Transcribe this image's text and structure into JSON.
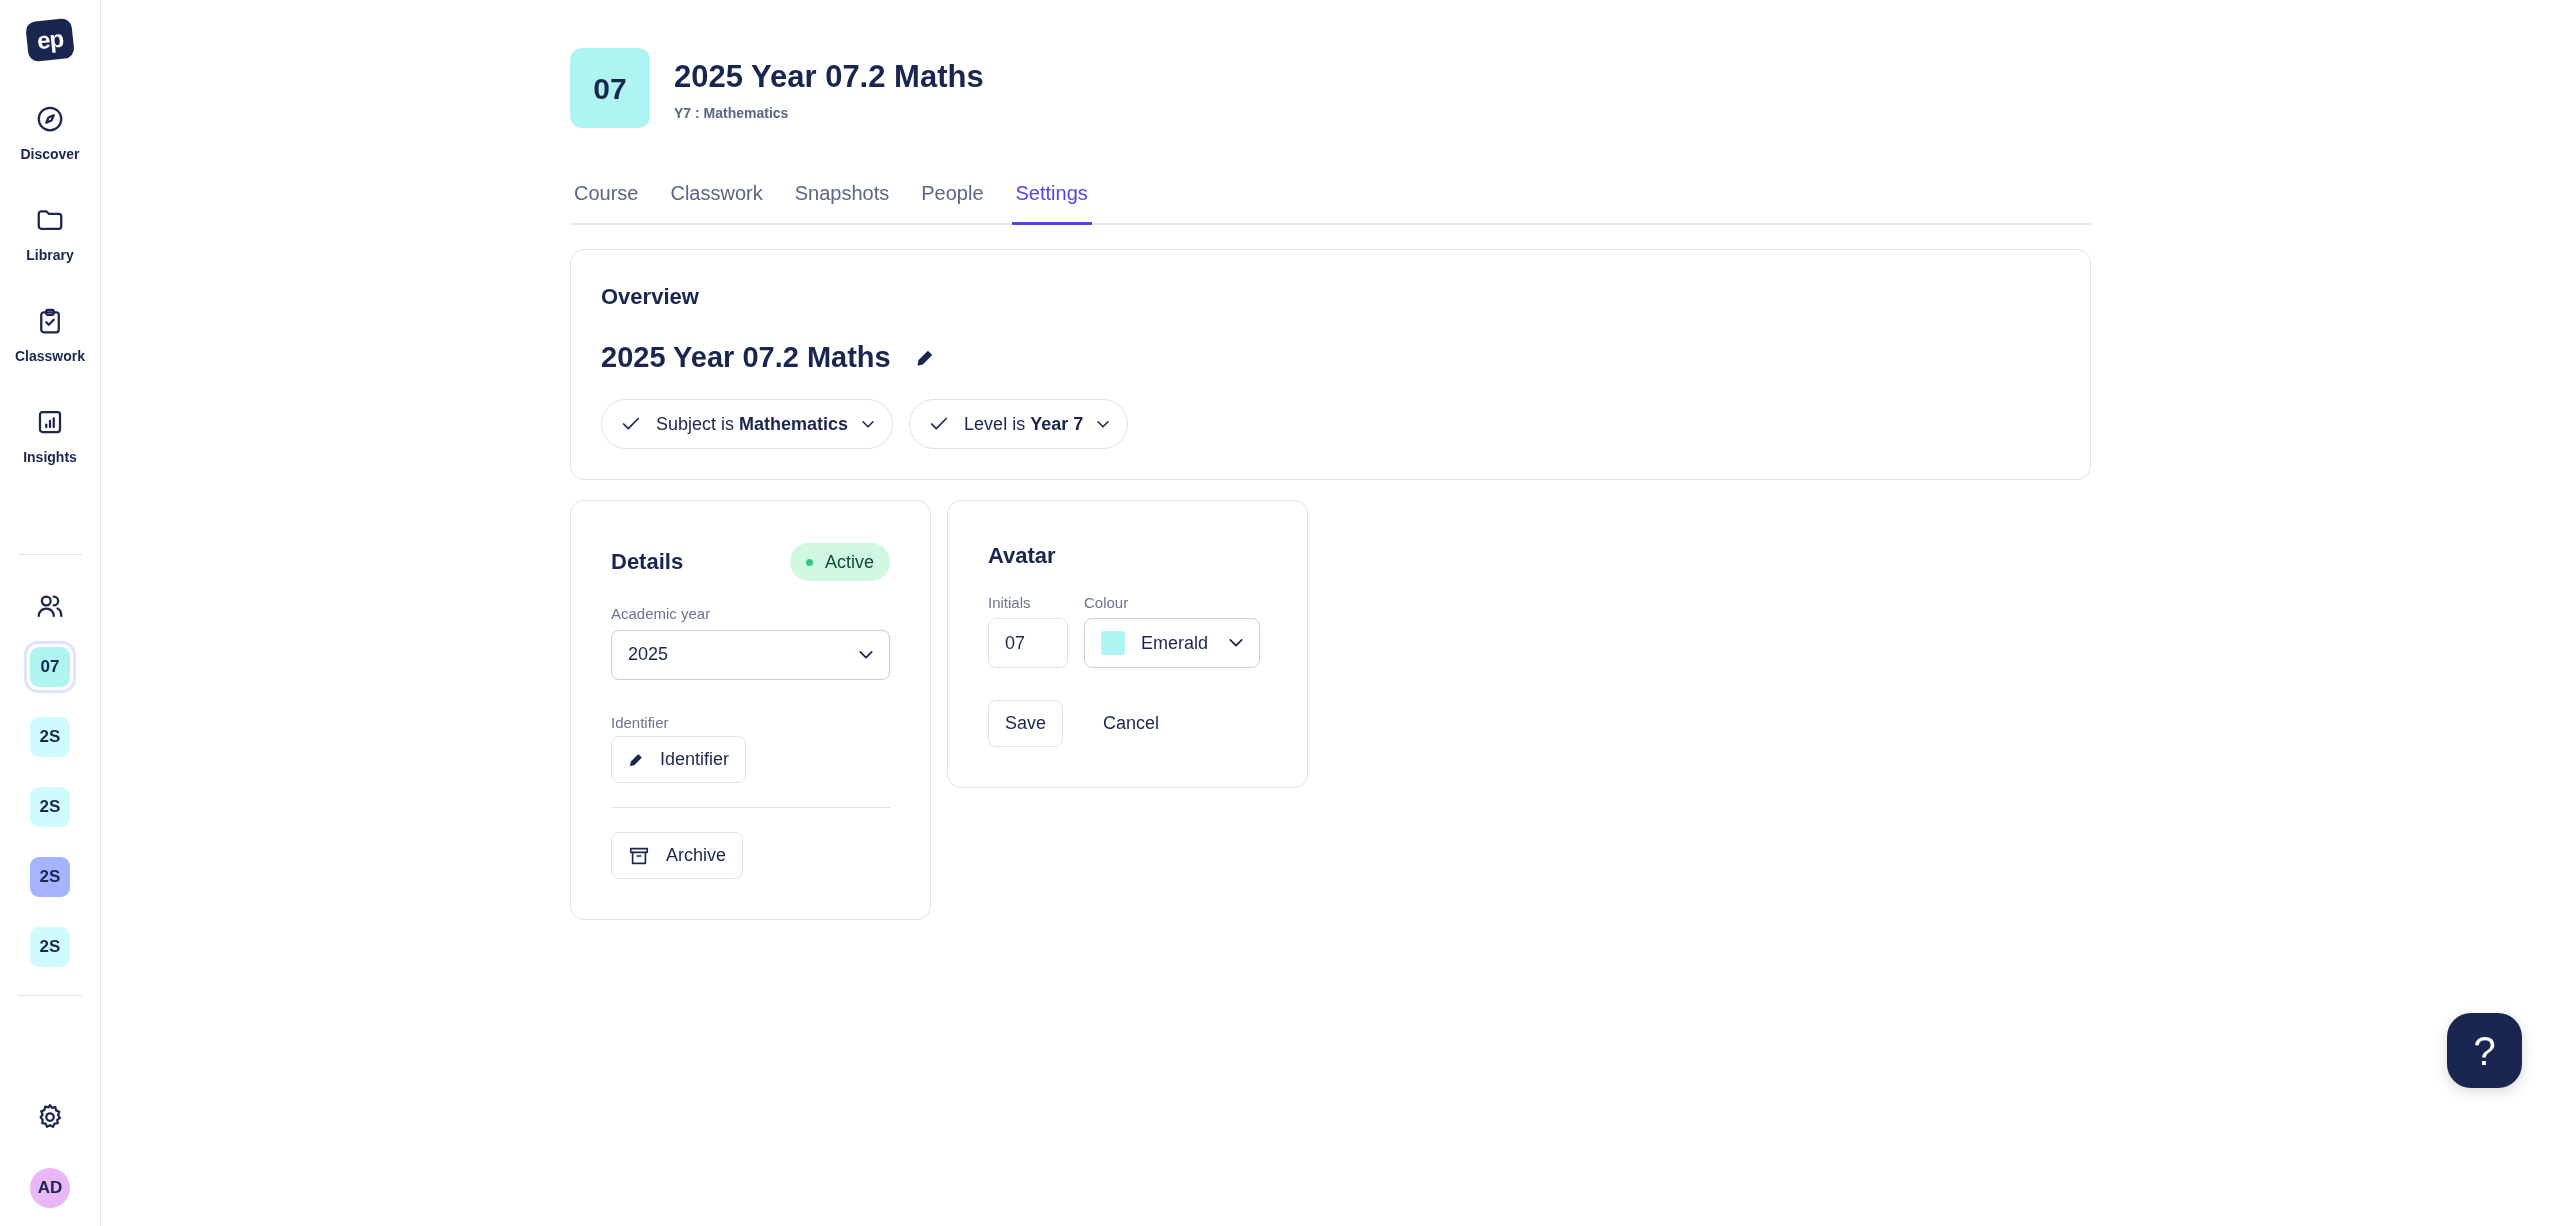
{
  "sidebar": {
    "logo": "ep",
    "nav": [
      {
        "label": "Discover"
      },
      {
        "label": "Library"
      },
      {
        "label": "Classwork"
      },
      {
        "label": "Insights"
      }
    ],
    "classes": [
      {
        "initials": "07",
        "color": "#aef5f1",
        "selected": true
      },
      {
        "initials": "2S",
        "color": "#cffafe",
        "selected": false
      },
      {
        "initials": "2S",
        "color": "#cffafe",
        "selected": false
      },
      {
        "initials": "2S",
        "color": "#a5b4fc",
        "selected": false
      },
      {
        "initials": "2S",
        "color": "#cffafe",
        "selected": false
      }
    ],
    "user": "AD"
  },
  "header": {
    "initials": "07",
    "color": "#aef5f1",
    "title": "2025 Year 07.2 Maths",
    "subtitle": "Y7 : Mathematics"
  },
  "tabs": [
    {
      "label": "Course",
      "selected": false
    },
    {
      "label": "Classwork",
      "selected": false
    },
    {
      "label": "Snapshots",
      "selected": false
    },
    {
      "label": "People",
      "selected": false
    },
    {
      "label": "Settings",
      "selected": true
    }
  ],
  "overview": {
    "heading": "Overview",
    "name": "2025 Year 07.2 Maths",
    "filters": [
      {
        "text": "Subject is **Mathematics**"
      },
      {
        "text": "Level is **Year 7**"
      }
    ]
  },
  "details": {
    "heading": "Details",
    "status": "Active",
    "year_label": "Academic year",
    "year_value": "2025",
    "identifier_label": "Identifier",
    "identifier_button": "Identifier",
    "archive_button": "Archive"
  },
  "avatar": {
    "heading": "Avatar",
    "initials_label": "Initials",
    "initials_value": "07",
    "colour_label": "Colour",
    "colour_value": "Emerald",
    "color": "#aef5f1",
    "save_button": "Save",
    "cancel_button": "Cancel"
  },
  "help": "?"
}
